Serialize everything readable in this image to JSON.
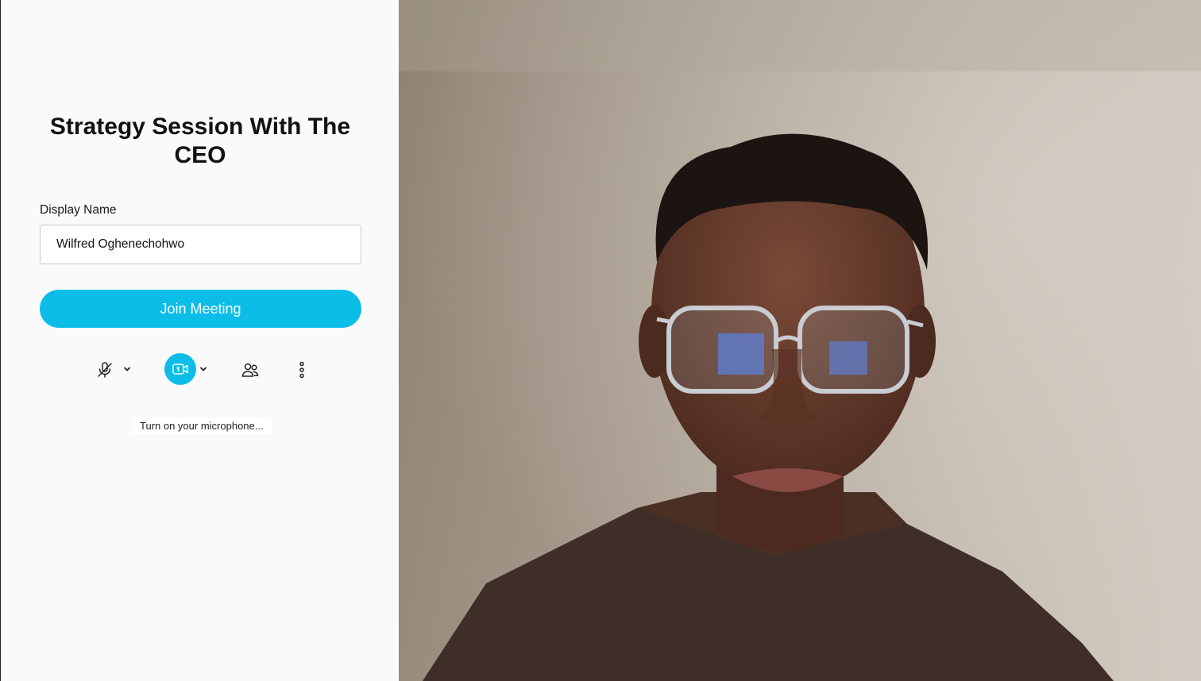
{
  "meeting": {
    "title": "Strategy Session With The CEO"
  },
  "form": {
    "display_name_label": "Display Name",
    "display_name_value": "Wilfred Oghenechohwo"
  },
  "actions": {
    "join_label": "Join Meeting"
  },
  "controls": {
    "microphone": {
      "icon": "microphone-off-icon",
      "state": "off"
    },
    "camera": {
      "icon": "video-camera-icon",
      "state": "on"
    },
    "participants": {
      "icon": "people-icon"
    },
    "more": {
      "icon": "more-vertical-icon"
    }
  },
  "hint": {
    "text": "Turn on your microphone..."
  },
  "colors": {
    "accent": "#0cbde8",
    "panel_bg": "#fafafa",
    "text": "#111111"
  }
}
